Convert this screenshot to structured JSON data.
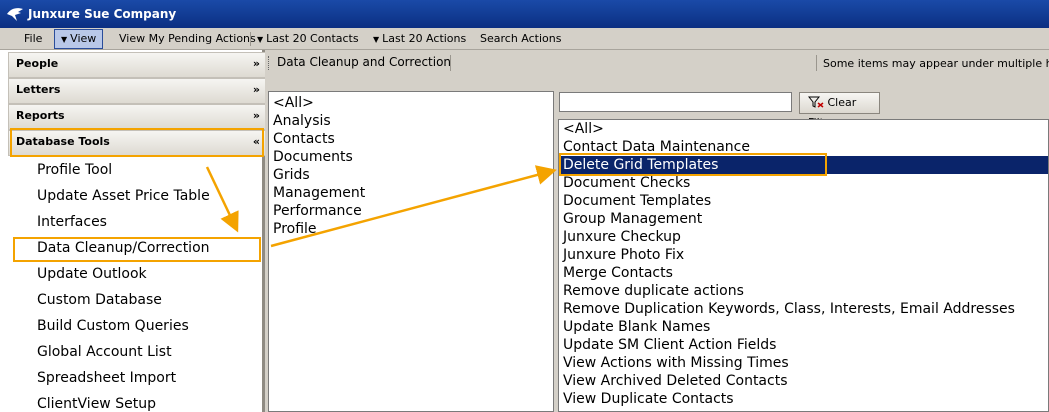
{
  "app": {
    "title": "Junxure Sue Company"
  },
  "menu": {
    "file": "File",
    "view": "View",
    "pending": "View My Pending Actions",
    "last_contacts": "Last 20 Contacts",
    "last_actions": "Last 20 Actions",
    "search_actions": "Search Actions"
  },
  "sidebar": {
    "groups": [
      {
        "label": "People",
        "chevron": "»"
      },
      {
        "label": "Letters",
        "chevron": "»"
      },
      {
        "label": "Reports",
        "chevron": "»"
      },
      {
        "label": "Database Tools",
        "chevron": "«"
      }
    ],
    "items": [
      "Profile Tool",
      "Update Asset Price Table",
      "Interfaces",
      "Data Cleanup/Correction",
      "Update Outlook",
      "Custom Database",
      "Build Custom Queries",
      "Global Account List",
      "Spreadsheet Import",
      "ClientView Setup"
    ]
  },
  "panel": {
    "breadcrumb": "Data Cleanup and Correction",
    "notice": "Some items may appear under multiple headings"
  },
  "categories": [
    "<All>",
    "Analysis",
    "Contacts",
    "Documents",
    "Grids",
    "Management",
    "Performance",
    "Profile"
  ],
  "filter": {
    "value": "",
    "button_label": "Clear Filter"
  },
  "tools": [
    "<All>",
    "Contact Data Maintenance",
    "Delete Grid Templates",
    "Document Checks",
    "Document Templates",
    "Group Management",
    "Junxure Checkup",
    "Junxure Photo Fix",
    "Merge Contacts",
    "Remove duplicate actions",
    "Remove Duplication Keywords, Class, Interests, Email Addresses",
    "Update Blank Names",
    "Update SM Client Action Fields",
    "View Actions with Missing Times",
    "View Archived Deleted Contacts",
    "View Duplicate Contacts"
  ],
  "colors": {
    "selection": "#0a246a",
    "annotation": "#f4a300"
  }
}
